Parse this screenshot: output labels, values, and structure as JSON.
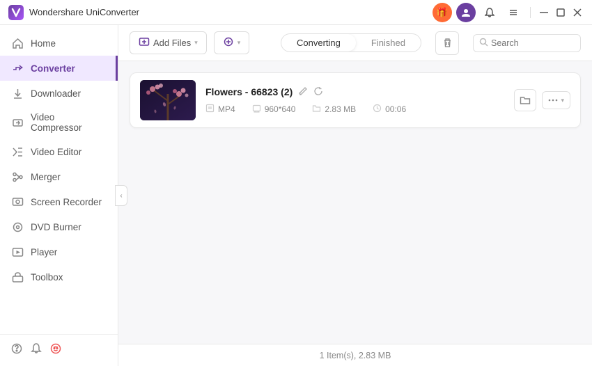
{
  "app": {
    "name": "Wondershare UniConverter",
    "logo_char": "W"
  },
  "title_bar": {
    "gift_icon": "🎁",
    "user_icon": "👤",
    "bell_icon": "🔔",
    "menu_icon": "☰",
    "minimize_icon": "─",
    "maximize_icon": "□",
    "close_icon": "✕"
  },
  "sidebar": {
    "items": [
      {
        "id": "home",
        "label": "Home",
        "icon": "⊙",
        "active": false
      },
      {
        "id": "converter",
        "label": "Converter",
        "icon": "⇄",
        "active": true
      },
      {
        "id": "downloader",
        "label": "Downloader",
        "icon": "↓",
        "active": false
      },
      {
        "id": "video-compressor",
        "label": "Video Compressor",
        "icon": "▣",
        "active": false
      },
      {
        "id": "video-editor",
        "label": "Video Editor",
        "icon": "✂",
        "active": false
      },
      {
        "id": "merger",
        "label": "Merger",
        "icon": "⊕",
        "active": false
      },
      {
        "id": "screen-recorder",
        "label": "Screen Recorder",
        "icon": "⏺",
        "active": false
      },
      {
        "id": "dvd-burner",
        "label": "DVD Burner",
        "icon": "◎",
        "active": false
      },
      {
        "id": "player",
        "label": "Player",
        "icon": "▶",
        "active": false
      },
      {
        "id": "toolbox",
        "label": "Toolbox",
        "icon": "⚙",
        "active": false
      }
    ],
    "bottom_icons": [
      "?",
      "🔔",
      "😊"
    ],
    "collapse_icon": "‹"
  },
  "toolbar": {
    "add_file_label": "Add Files",
    "add_url_label": "",
    "converting_tab": "Converting",
    "finished_tab": "Finished",
    "search_placeholder": "Search"
  },
  "file_list": {
    "items": [
      {
        "name": "Flowers - 66823 (2)",
        "format": "MP4",
        "resolution": "960*640",
        "size": "2.83 MB",
        "duration": "00:06"
      }
    ]
  },
  "status_bar": {
    "text": "1 Item(s), 2.83 MB"
  }
}
